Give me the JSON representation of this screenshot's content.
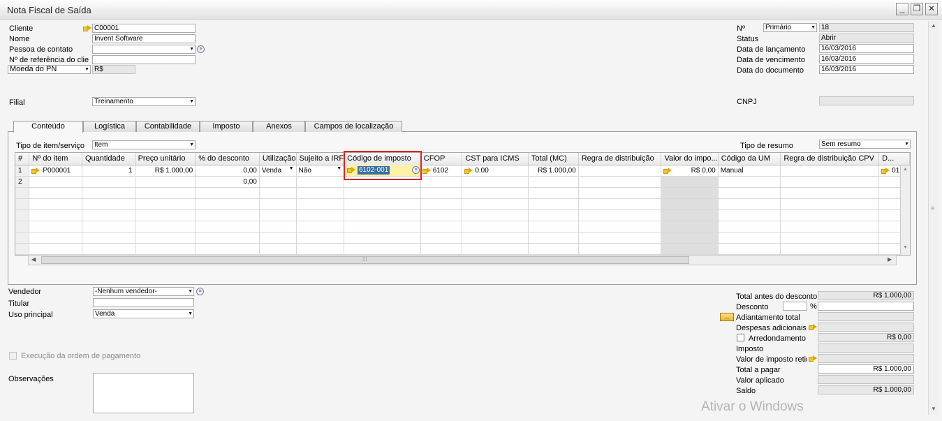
{
  "window": {
    "title": "Nota Fiscal de Saída",
    "minimize": "_",
    "restore": "❐",
    "close": "✕"
  },
  "header_left": {
    "cliente_label": "Cliente",
    "cliente_value": "C00001",
    "nome_label": "Nome",
    "nome_value": "Invent Software",
    "contato_label": "Pessoa de contato",
    "contato_value": "",
    "referencia_label": "Nº de referência do clie",
    "referencia_value": "",
    "moeda_label": "Moeda do PN",
    "moeda_value": "R$",
    "filial_label": "Filial",
    "filial_value": "Treinamento"
  },
  "header_right": {
    "numero_label": "Nº",
    "serie_value": "Primário",
    "numero_value": "18",
    "status_label": "Status",
    "status_value": "Abrir",
    "lancamento_label": "Data de lançamento",
    "lancamento_value": "16/03/2016",
    "vencimento_label": "Data de vencimento",
    "vencimento_value": "16/03/2016",
    "documento_label": "Data do documento",
    "documento_value": "16/03/2016",
    "cnpj_label": "CNPJ",
    "cnpj_value": ""
  },
  "tabs": [
    "Conteúdo",
    "Logística",
    "Contabilidade",
    "Imposto",
    "Anexos",
    "Campos de localização"
  ],
  "content": {
    "tipo_item_label": "Tipo de item/serviço",
    "tipo_item_value": "Item",
    "tipo_resumo_label": "Tipo de resumo",
    "tipo_resumo_value": "Sem resumo"
  },
  "grid": {
    "columns": [
      "#",
      "Nº do item",
      "Quantidade",
      "Preço unitário",
      "% do desconto",
      "Utilização",
      "Sujeito a IRF",
      "Código de imposto",
      "CFOP",
      "CST para ICMS",
      "Total (MC)",
      "Regra de distribuição",
      "Valor do impo...",
      "Código da UM",
      "Regra de distribuição CPV",
      "D..."
    ],
    "row1": {
      "num": "1",
      "item": "P000001",
      "quantidade": "1",
      "preco": "R$ 1.000,00",
      "desconto": "0,00",
      "utilizacao": "Venda",
      "irf": "Não",
      "codigo_imposto": "6102-001",
      "cfop": "6102",
      "cst": "0.00",
      "total": "R$ 1.000,00",
      "regra": "",
      "valor_imposto": "R$ 0,00",
      "um": "Manual",
      "regra_cpv": "",
      "d": "01"
    },
    "row2": {
      "num": "2",
      "desconto": "0,00"
    }
  },
  "footer_left": {
    "vendedor_label": "Vendedor",
    "vendedor_value": "-Nenhum vendedor-",
    "titular_label": "Titular",
    "titular_value": "",
    "uso_label": "Uso principal",
    "uso_value": "Venda",
    "execucao_label": "Execução da ordem de pagamento",
    "obs_label": "Observações"
  },
  "totals": {
    "antes_desconto_label": "Total antes do desconto",
    "antes_desconto_value": "R$ 1.000,00",
    "desconto_label": "Desconto",
    "desconto_pct": "",
    "pct_symbol": "%",
    "desconto_value": "",
    "adiantamento_button": "...",
    "adiantamento_label": "Adiantamento total",
    "adiantamento_value": "",
    "despesas_label": "Despesas adicionais",
    "despesas_value": "",
    "arredondamento_label": "Arredondamento",
    "arredondamento_value": "R$ 0,00",
    "imposto_label": "Imposto",
    "imposto_value": "",
    "retido_label": "Valor de imposto retido",
    "retido_value": "",
    "total_pagar_label": "Total a pagar",
    "total_pagar_value": "R$ 1.000,00",
    "aplicado_label": "Valor aplicado",
    "aplicado_value": "",
    "saldo_label": "Saldo",
    "saldo_value": "R$ 1.000,00"
  },
  "watermark": "Ativar o Windows"
}
